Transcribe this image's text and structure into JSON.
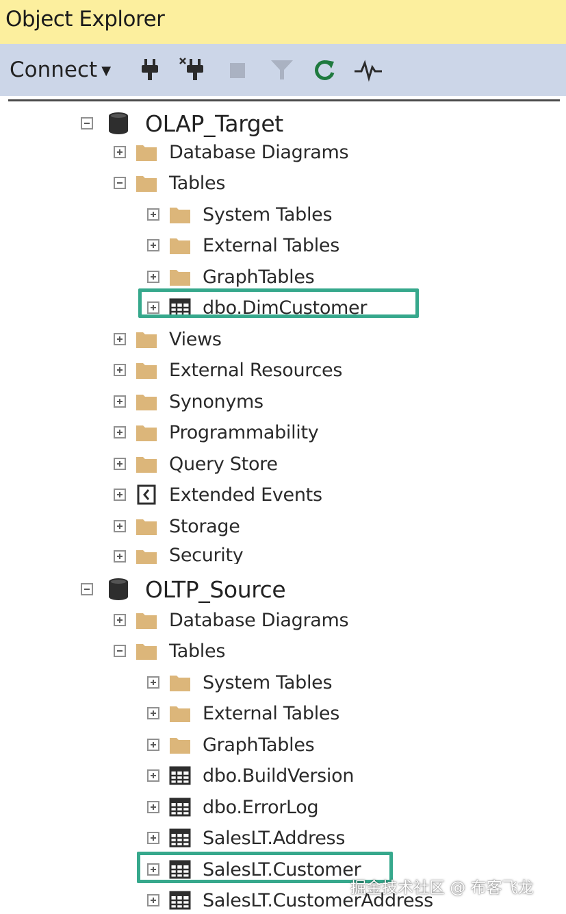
{
  "panel": {
    "title": "Object Explorer",
    "connect_label": "Connect",
    "toolbar_icons": [
      "connect-plug-icon",
      "disconnect-plug-icon",
      "stop-icon",
      "filter-icon",
      "refresh-icon",
      "activity-monitor-icon"
    ]
  },
  "tree": {
    "olap": {
      "name": "OLAP_Target",
      "items": [
        "Database Diagrams",
        "Tables",
        "System Tables",
        "External Tables",
        "GraphTables",
        "dbo.DimCustomer",
        "Views",
        "External Resources",
        "Synonyms",
        "Programmability",
        "Query Store",
        "Extended Events",
        "Storage",
        "Security"
      ]
    },
    "oltp": {
      "name": "OLTP_Source",
      "items": [
        "Database Diagrams",
        "Tables",
        "System Tables",
        "External Tables",
        "GraphTables",
        "dbo.BuildVersion",
        "dbo.ErrorLog",
        "SalesLT.Address",
        "SalesLT.Customer",
        "SalesLT.CustomerAddress"
      ]
    }
  },
  "colors": {
    "title_bar": "#fcef9e",
    "toolbar": "#ccd6e8",
    "highlight": "#36a88c",
    "folder": "#dcb67a"
  },
  "watermark": "掘金技术社区 @ 布客飞龙"
}
